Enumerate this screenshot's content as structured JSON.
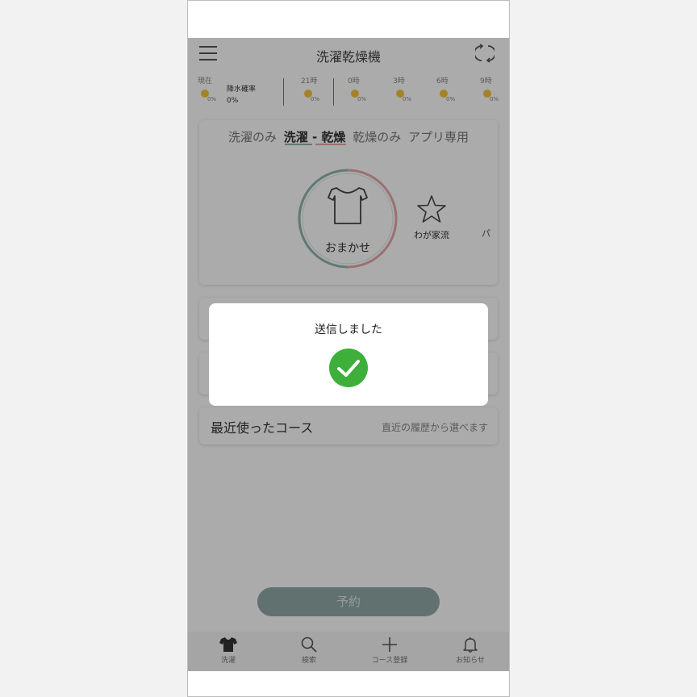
{
  "header": {
    "title": "洗濯乾燥機"
  },
  "weather": {
    "now_label": "現在",
    "rain_label": "降水確率",
    "rain_value": "0%",
    "hours": [
      {
        "label": "21時",
        "percent": "0%"
      },
      {
        "label": "0時",
        "percent": "0%"
      },
      {
        "label": "3時",
        "percent": "0%"
      },
      {
        "label": "6時",
        "percent": "0%"
      },
      {
        "label": "9時",
        "percent": "0%"
      }
    ],
    "now_percent": "0%"
  },
  "course_tabs": [
    {
      "label": "洗濯のみ",
      "active": false
    },
    {
      "label": "洗濯 - 乾燥",
      "active": true
    },
    {
      "label": "乾燥のみ",
      "active": false
    },
    {
      "label": "アプリ専用",
      "active": false
    }
  ],
  "course_items": {
    "primary": "おまかせ",
    "secondary": "わが家流",
    "partial": "パ"
  },
  "recent": {
    "title": "最近使ったコース",
    "subtitle": "直近の履歴から選べます"
  },
  "reserve_button": "予約",
  "tabbar": [
    {
      "label": "洗濯",
      "icon": "shirt-icon"
    },
    {
      "label": "検索",
      "icon": "search-icon"
    },
    {
      "label": "コース登録",
      "icon": "plus-icon"
    },
    {
      "label": "お知らせ",
      "icon": "bell-icon"
    }
  ],
  "modal": {
    "message": "送信しました",
    "icon": "check-icon"
  },
  "colors": {
    "teal": "#8fb5ae",
    "pink": "#e8a7a7",
    "success": "#3eaf3a"
  }
}
